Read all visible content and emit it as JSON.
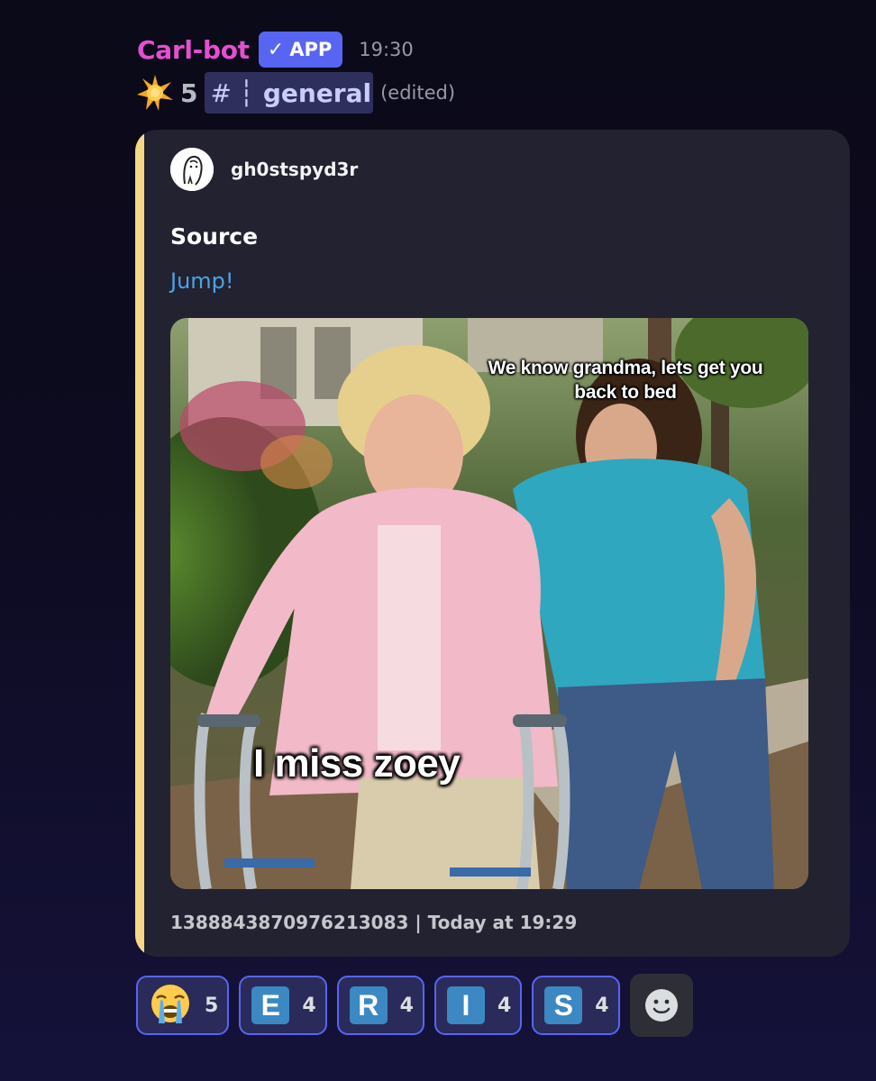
{
  "message": {
    "author": "Carl-bot",
    "badge": "APP",
    "badge_check": "✓",
    "timestamp": "19:30",
    "star_count": "5",
    "channel_hash": "#",
    "channel_separator": "┆",
    "channel_name": "general",
    "edited_label": "(edited)",
    "author_color": "#e44fcf"
  },
  "embed": {
    "author_name": "gh0stspyd3r",
    "title": "Source",
    "link_text": "Jump!",
    "accent_color": "#f5d886",
    "image": {
      "caption_top": "We know grandma, lets get you back to bed",
      "caption_bottom": "I miss zoey"
    },
    "footer": "1388843870976213083 | Today at 19:29"
  },
  "reactions": [
    {
      "icon": "loudly-crying-face-icon",
      "count": "5"
    },
    {
      "icon": "regional-indicator-e-icon",
      "letter": "E",
      "count": "4"
    },
    {
      "icon": "regional-indicator-r-icon",
      "letter": "R",
      "count": "4"
    },
    {
      "icon": "regional-indicator-i-icon",
      "letter": "I",
      "count": "4"
    },
    {
      "icon": "regional-indicator-s-icon",
      "letter": "S",
      "count": "4"
    }
  ],
  "colors": {
    "accent": "#5865f2",
    "link": "#4aa3e8",
    "reaction_bg": "#2a2b5a",
    "letter_tile": "#3b88c3"
  }
}
